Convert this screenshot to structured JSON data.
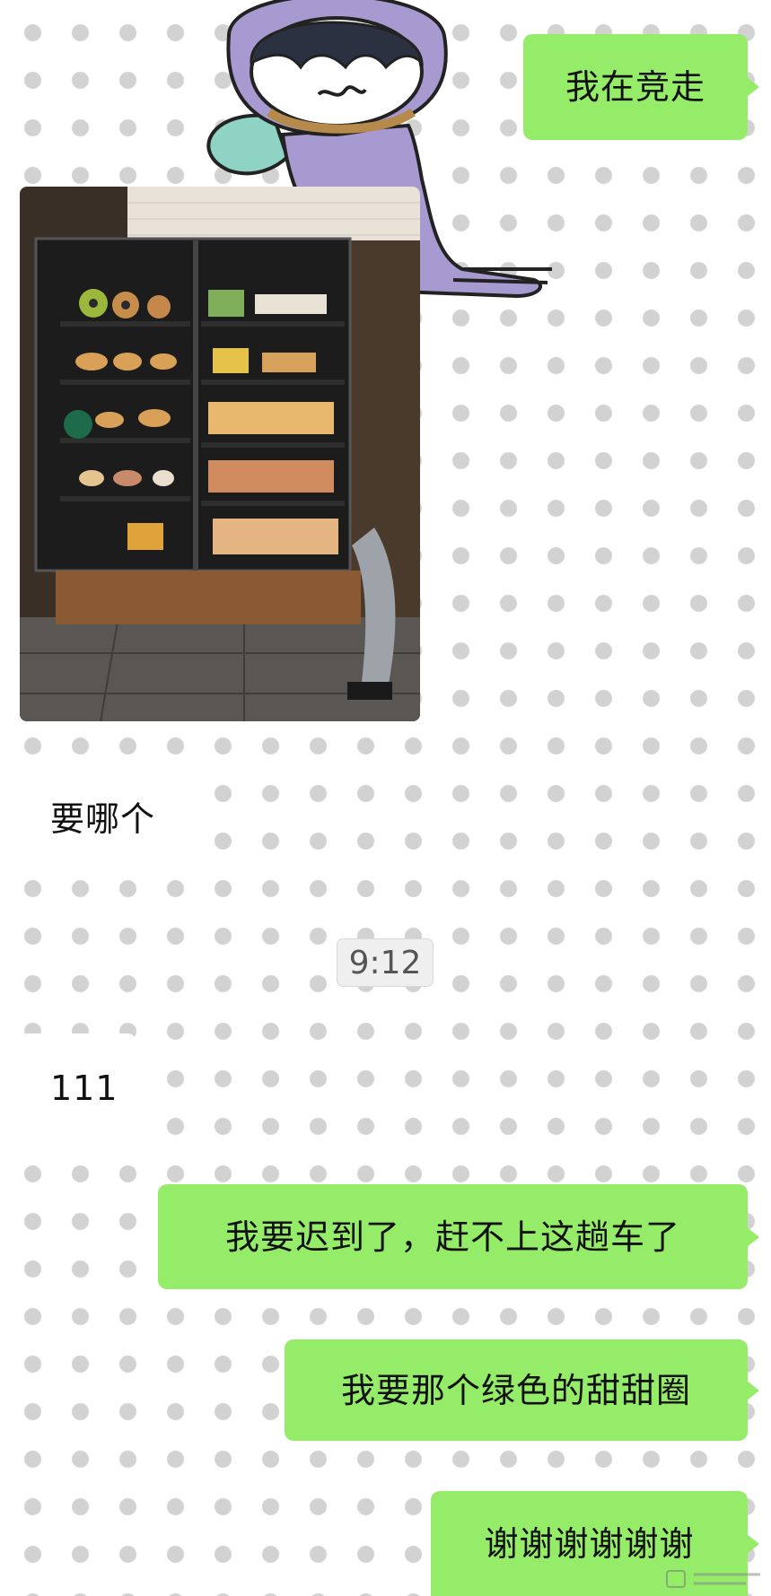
{
  "messages": {
    "race": "我在竞走",
    "which_one": "要哪个",
    "ones": "111",
    "late": "我要迟到了，赶不上这趟车了",
    "green_donut": "我要那个绿色的甜甜圈",
    "thanks": "谢谢谢谢谢谢"
  },
  "timestamp": "9:12",
  "colors": {
    "outgoing_bubble": "#95ec69",
    "incoming_bubble": "#ffffff",
    "background": "#ffffff",
    "dots": "#d2d2d2",
    "sticker_purple": "#a79ad0",
    "sticker_wing": "#8fd3c4"
  },
  "photo": {
    "subject": "bakery-display-case-photo"
  },
  "sticker": {
    "icon": "purple-hooded-character-sticker"
  }
}
